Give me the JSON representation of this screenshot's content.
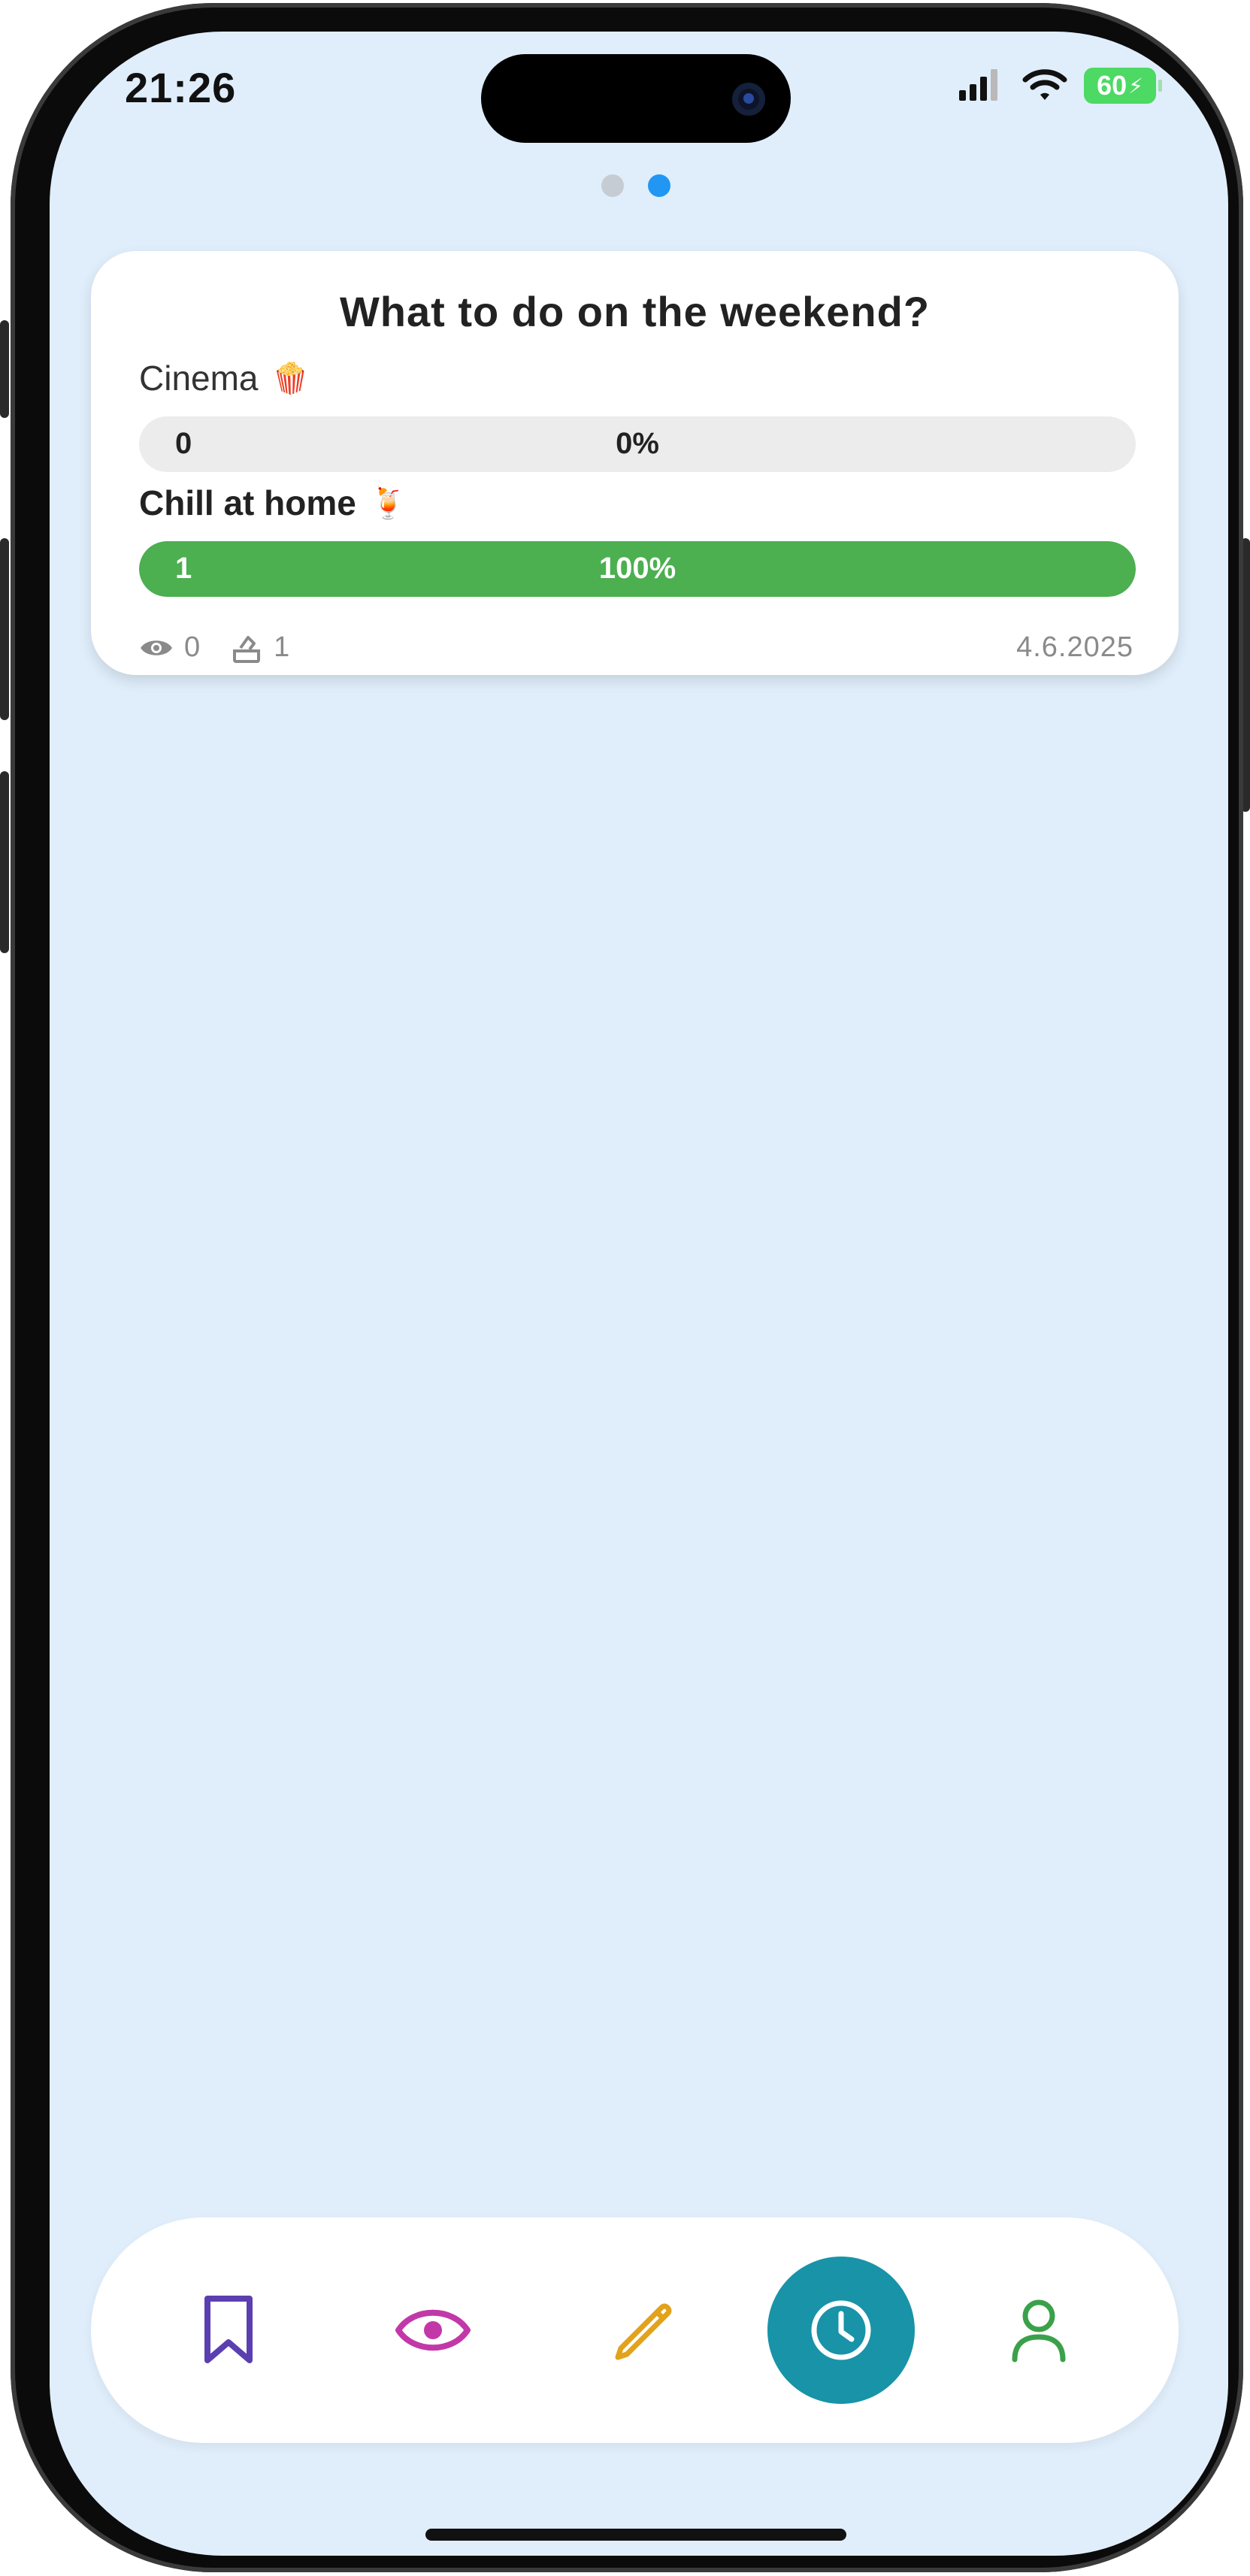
{
  "status_bar": {
    "time": "21:26",
    "battery": "60"
  },
  "pager": {
    "pages": 2,
    "active_index": 1
  },
  "poll": {
    "title": "What to do on the weekend?",
    "options": [
      {
        "label": "Cinema",
        "emoji": "🍿",
        "count": "0",
        "percent_text": "0%",
        "percent": 0,
        "leading": false
      },
      {
        "label": "Chill at home",
        "emoji": "🍹",
        "count": "1",
        "percent_text": "100%",
        "percent": 100,
        "leading": true
      }
    ],
    "views": "0",
    "votes": "1",
    "date": "4.6.2025",
    "colors": {
      "winner_bar": "#4caf50",
      "empty_bar": "#ececec"
    }
  },
  "nav": {
    "items": [
      {
        "name": "bookmark-icon",
        "color": "#5b3fb0"
      },
      {
        "name": "eye-icon",
        "color": "#c238a8"
      },
      {
        "name": "pencil-icon",
        "color": "#e2a21a"
      },
      {
        "name": "clock-icon",
        "color": "#ffffff",
        "active": true,
        "active_bg": "#1893a8"
      },
      {
        "name": "user-icon",
        "color": "#3aa14a"
      }
    ]
  }
}
